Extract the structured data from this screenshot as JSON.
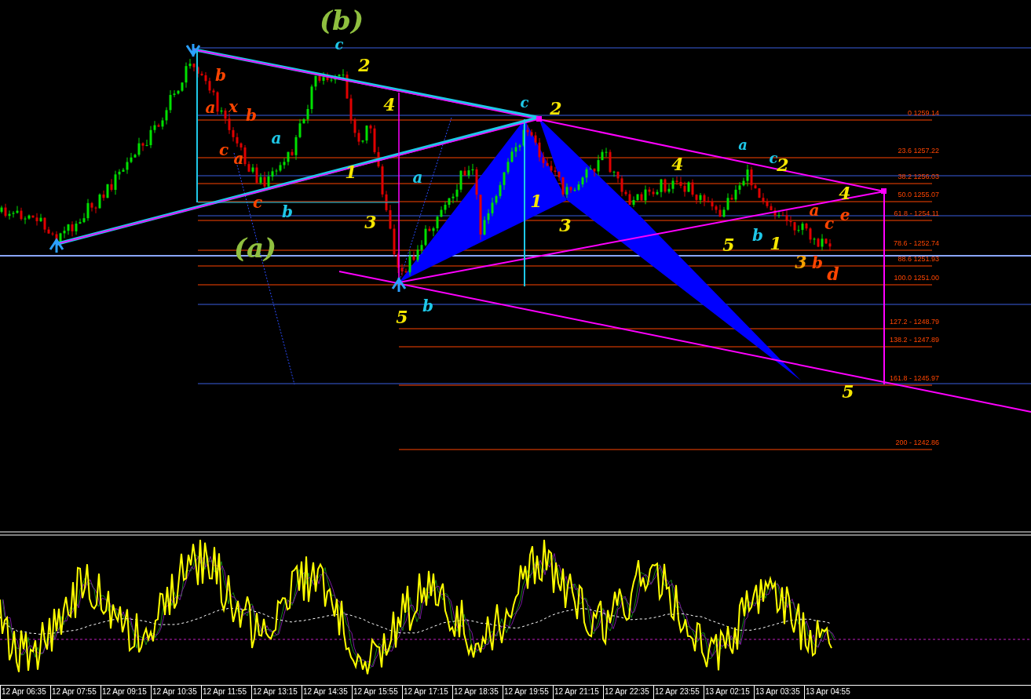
{
  "chart": {
    "wave_labels": [
      {
        "text": "(b)",
        "color": "#8fbf3f"
      },
      {
        "text": "c",
        "color": "#1ec8e8"
      },
      {
        "text": "2",
        "color": "#f5e600"
      },
      {
        "text": "b",
        "color": "#ff4500"
      },
      {
        "text": "a",
        "color": "#ff4500"
      },
      {
        "text": "x",
        "color": "#ff4500"
      },
      {
        "text": "4",
        "color": "#f5e600"
      },
      {
        "text": "c",
        "color": "#1ec8e8"
      },
      {
        "text": "2",
        "color": "#f5e600"
      },
      {
        "text": "b",
        "color": "#ff4500"
      },
      {
        "text": "a",
        "color": "#1ec8e8"
      },
      {
        "text": "a",
        "color": "#1ec8e8"
      },
      {
        "text": "c",
        "color": "#ff4500"
      },
      {
        "text": "a",
        "color": "#ff4500"
      },
      {
        "text": "c",
        "color": "#1ec8e8"
      },
      {
        "text": "1",
        "color": "#f5e600"
      },
      {
        "text": "4",
        "color": "#f5e600"
      },
      {
        "text": "2",
        "color": "#f5e600"
      },
      {
        "text": "a",
        "color": "#1ec8e8"
      },
      {
        "text": "c",
        "color": "#ff4500"
      },
      {
        "text": "1",
        "color": "#f5e600"
      },
      {
        "text": "4",
        "color": "#f5e600"
      },
      {
        "text": "b",
        "color": "#1ec8e8"
      },
      {
        "text": "a",
        "color": "#ff4500"
      },
      {
        "text": "e",
        "color": "#ff4500"
      },
      {
        "text": "3",
        "color": "#f5e600"
      },
      {
        "text": "3",
        "color": "#f5e600"
      },
      {
        "text": "c",
        "color": "#ff4500"
      },
      {
        "text": "b",
        "color": "#1ec8e8"
      },
      {
        "text": "(a)",
        "color": "#8fbf3f"
      },
      {
        "text": "5",
        "color": "#f5e600"
      },
      {
        "text": "1",
        "color": "#f5e600"
      },
      {
        "text": "3",
        "color": "#f5a000"
      },
      {
        "text": "b",
        "color": "#ff4500"
      },
      {
        "text": "d",
        "color": "#ff4500"
      },
      {
        "text": "5",
        "color": "#f5e600"
      },
      {
        "text": "b",
        "color": "#1ec8e8"
      },
      {
        "text": "5",
        "color": "#f5e600"
      }
    ],
    "fib_levels": [
      {
        "label": "0 1259.14"
      },
      {
        "label": "23.6 1257.22"
      },
      {
        "label": "38.2 1256.03"
      },
      {
        "label": "50.0 1255.07"
      },
      {
        "label": "61.8 - 1254.11"
      },
      {
        "label": "78.6 - 1252.74"
      },
      {
        "label": "88.6 1251.93"
      },
      {
        "label": "100.0 1251.00"
      },
      {
        "label": "127.2 - 1248.79"
      },
      {
        "label": "138.2 - 1247.89"
      },
      {
        "label": "161.8 -  1245.97"
      },
      {
        "label": "200 - 1242.86"
      }
    ]
  },
  "time_axis": {
    "labels": [
      "12 Apr 06:35",
      "12 Apr 07:55",
      "12 Apr 09:15",
      "12 Apr 10:35",
      "12 Apr 11:55",
      "12 Apr 13:15",
      "12 Apr 14:35",
      "12 Apr 15:55",
      "12 Apr 17:15",
      "12 Apr 18:35",
      "12 Apr 19:55",
      "12 Apr 21:15",
      "12 Apr 22:35",
      "12 Apr 23:55",
      "13 Apr 02:15",
      "13 Apr 03:35",
      "13 Apr 04:55"
    ]
  }
}
